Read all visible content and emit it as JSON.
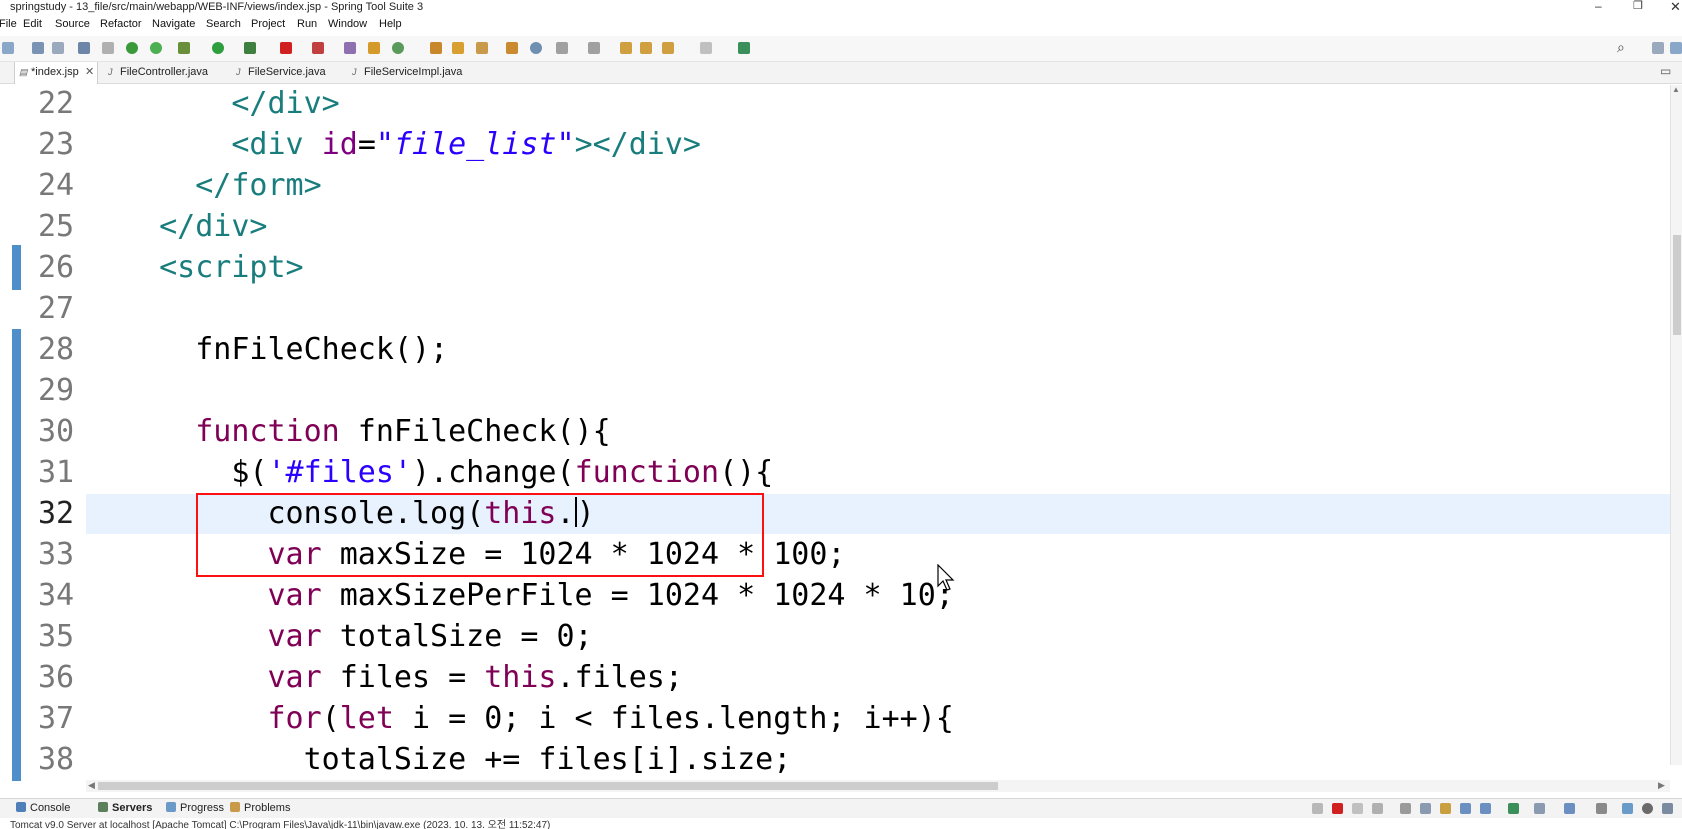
{
  "window": {
    "title": "springstudy - 13_file/src/main/webapp/WEB-INF/views/index.jsp - Spring Tool Suite 3",
    "minimize": "–",
    "restore": "❐",
    "close": "✕"
  },
  "menu": [
    "File",
    "Edit",
    "Source",
    "Refactor",
    "Navigate",
    "Search",
    "Project",
    "Run",
    "Window",
    "Help"
  ],
  "toolbar": {
    "search_icon": "search-icon"
  },
  "tabs": [
    {
      "label": "*index.jsp",
      "icon": "jsp-file-icon"
    },
    {
      "label": "FileController.java",
      "icon": "java-file-icon"
    },
    {
      "label": "FileService.java",
      "icon": "java-file-icon"
    },
    {
      "label": "FileServiceImpl.java",
      "icon": "java-file-icon"
    }
  ],
  "editor": {
    "current_line": "32",
    "lines": [
      {
        "n": "22"
      },
      {
        "n": "23"
      },
      {
        "n": "24"
      },
      {
        "n": "25"
      },
      {
        "n": "26"
      },
      {
        "n": "27"
      },
      {
        "n": "28"
      },
      {
        "n": "29"
      },
      {
        "n": "30"
      },
      {
        "n": "31"
      },
      {
        "n": "32"
      },
      {
        "n": "33"
      },
      {
        "n": "34"
      },
      {
        "n": "35"
      },
      {
        "n": "36"
      },
      {
        "n": "37"
      },
      {
        "n": "38"
      }
    ],
    "code": {
      "l22": {
        "t1": "</div>"
      },
      "l23": {
        "t1": "<div ",
        "a1": "id",
        "eq": "=",
        "s1": "\"file_list\"",
        "t2": "></div>"
      },
      "l24": {
        "t1": "</form>"
      },
      "l25": {
        "t1": "</div>"
      },
      "l26": {
        "t1": "<script>"
      },
      "l28": {
        "p1": "fnFileCheck();"
      },
      "l30": {
        "k1": "function",
        "p1": " fnFileCheck(){"
      },
      "l31": {
        "p1": "$(",
        "s1": "'#files'",
        "p2": ").change(",
        "k1": "function",
        "p3": "(){"
      },
      "l32": {
        "p1": "console.log(",
        "k1": "this",
        "p2": ".",
        "p3": ")"
      },
      "l33": {
        "k1": "var",
        "p1": " maxSize = 1024 * 1024 * 100;"
      },
      "l34": {
        "k1": "var",
        "p1": " maxSizePerFile = 1024 * 1024 * 10;"
      },
      "l35": {
        "k1": "var",
        "p1": " totalSize = 0;"
      },
      "l36": {
        "k1": "var",
        "p1": " files = ",
        "k2": "this",
        "p2": ".files;"
      },
      "l37": {
        "k1": "for",
        "p1": "(",
        "k2": "let",
        "p2": " i = 0; i < files.length; i++){"
      },
      "l38": {
        "p1": "totalSize += files[i].size;"
      }
    }
  },
  "bottom_tabs": [
    {
      "label": "Console",
      "bold": false
    },
    {
      "label": "Servers",
      "bold": true
    },
    {
      "label": "Progress",
      "bold": false
    },
    {
      "label": "Problems",
      "bold": false
    }
  ],
  "status": {
    "text": "Tomcat v9.0 Server at localhost [Apache Tomcat] C:\\Program Files\\Java\\jdk-11\\bin\\javaw.exe  (2023. 10. 13. 오전 11:52:47)"
  },
  "colors": {
    "highlight_box": "#ff1010",
    "current_line": "#e8f2fe",
    "change_bar": "#4f8fc9",
    "keyword": "#7f0055",
    "tag": "#1a7d7d",
    "string": "#2a00ff"
  }
}
